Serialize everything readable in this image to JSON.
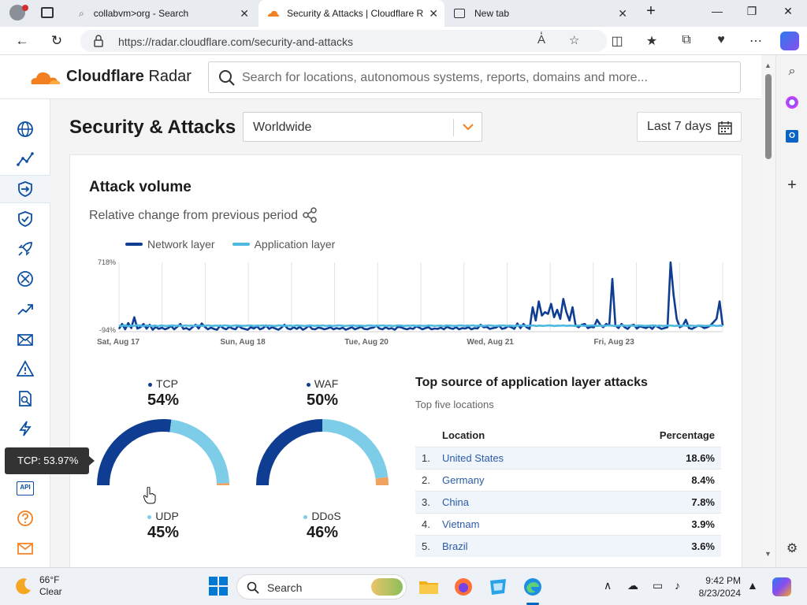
{
  "browser": {
    "tabs": [
      {
        "label": "collabvm>org - Search",
        "icon": "search-icon"
      },
      {
        "label": "Security & Attacks | Cloudflare R",
        "icon": "cloudflare-icon"
      },
      {
        "label": "New tab",
        "icon": "newtab-icon"
      }
    ],
    "url": "https://radar.cloudflare.com/security-and-attacks"
  },
  "header": {
    "brand_name": "Cloudflare",
    "brand_product": "Radar",
    "search_placeholder": "Search for locations, autonomous systems, reports, domains and more..."
  },
  "nav": {
    "items": [
      "globe-icon",
      "traffic-icon",
      "security-icon",
      "shield-icon",
      "rocket-icon",
      "network-icon",
      "trending-icon",
      "email-icon",
      "alert-icon",
      "domain-icon",
      "bolt-icon",
      "api-icon",
      "help-icon",
      "mail-icon"
    ],
    "api_label": "API",
    "selected": "security-icon"
  },
  "page": {
    "title": "Security & Attacks",
    "location": "Worldwide",
    "date_range": "Last 7 days"
  },
  "attack_volume": {
    "title": "Attack volume",
    "subtitle": "Relative change from previous period",
    "legend": [
      {
        "name": "Network layer",
        "color": "#0e3d92"
      },
      {
        "name": "Application layer",
        "color": "#4db8e0"
      }
    ],
    "y_max_label": "718%",
    "y_min_label": "-94%",
    "x_labels": [
      "Sat, Aug 17",
      "Sun, Aug 18",
      "Tue, Aug 20",
      "Wed, Aug 21",
      "Fri, Aug 23"
    ]
  },
  "chart_data": {
    "type": "line",
    "ylim": [
      -94,
      718
    ],
    "series": [
      {
        "name": "Network layer",
        "values": [
          -80,
          -20,
          -85,
          -10,
          -70,
          60,
          -75,
          -60,
          -20,
          -78,
          -30,
          -90,
          -55,
          -80,
          -65,
          -85,
          -70,
          -45,
          -85,
          -55,
          -20,
          -80,
          -70,
          -90,
          -60,
          -30,
          -75,
          -15,
          -55,
          -85,
          -65,
          -80,
          -90,
          -40,
          -70,
          -85,
          -55,
          -75,
          -85,
          -40,
          -70,
          -80,
          -90,
          -60,
          -75,
          -50,
          -85,
          -70,
          -40,
          -80,
          -60,
          -75,
          -90,
          -65,
          -30,
          -75,
          -85,
          -60,
          -80,
          -55,
          -90,
          -70,
          -40,
          -80,
          -85,
          -65,
          -70,
          -85,
          -75,
          -60,
          -85,
          -70,
          -80,
          -65,
          -90,
          -75,
          -60,
          -85,
          -70,
          -55,
          -80,
          -85,
          -70,
          -65,
          -40,
          -75,
          -85,
          -60,
          -80,
          -70,
          -90,
          -55,
          -60,
          -75,
          -85,
          -70,
          -80,
          -50,
          -65,
          -85,
          -70,
          -60,
          -85,
          -75,
          -80,
          -65,
          -85,
          -55,
          -70,
          -80,
          -60,
          -85,
          -70,
          -75,
          -60,
          -85,
          -70,
          -75,
          -30,
          -60,
          -55,
          -80,
          -70,
          -65,
          -40,
          -80,
          -70,
          -45,
          -60,
          -80,
          -15,
          -70,
          -20,
          -60,
          -80,
          180,
          20,
          250,
          80,
          120,
          100,
          220,
          60,
          150,
          40,
          280,
          120,
          20,
          180,
          -40,
          -60,
          -30,
          -20,
          -70,
          -55,
          -60,
          30,
          -30,
          -60,
          -20,
          -40,
          520,
          -40,
          -70,
          -20,
          -60,
          -80,
          -40,
          -30,
          -75,
          -50,
          -60,
          -70,
          -50,
          -80,
          -40,
          -60,
          -80,
          -70,
          -60,
          718,
          320,
          40,
          -60,
          -40,
          30,
          -70,
          -80,
          -60,
          -40,
          -50,
          -70,
          -60,
          -40,
          0,
          40,
          250,
          -40
        ]
      },
      {
        "name": "Application layer",
        "values": [
          -40,
          -45,
          -35,
          -50,
          -40,
          -45,
          -35,
          -40,
          -50,
          -38,
          -42,
          -45,
          -40,
          -48,
          -38,
          -42,
          -45,
          -40,
          -38,
          -44,
          -40,
          -46,
          -38,
          -42,
          -40,
          -45,
          -38,
          -42,
          -44,
          -40,
          -38,
          -45,
          -40,
          -42,
          -44,
          -38,
          -40,
          -46,
          -42,
          -38,
          -40,
          -44,
          -42,
          -40,
          -38,
          -45,
          -40,
          -42,
          -38,
          -44,
          -40,
          -42,
          -45,
          -38,
          -40,
          -44,
          -42,
          -40,
          -46,
          -38,
          -40,
          -42,
          -45,
          -40,
          -38,
          -44,
          -40,
          -42,
          -38,
          -45,
          -40,
          -44,
          -42,
          -38,
          -40,
          -45,
          -42,
          -40,
          -38,
          -44,
          -40,
          -42,
          -45,
          -38,
          -40,
          -44,
          -42,
          -40,
          -38,
          -45,
          -40,
          -44,
          -42,
          -38,
          -40,
          -45,
          -40,
          -42,
          -38,
          -44,
          -40,
          -42,
          -45,
          -38,
          -40,
          -44,
          -42,
          -40,
          -46,
          -38,
          -40,
          -42,
          -45,
          -40,
          -38,
          -44,
          -40,
          -42,
          -38,
          -45,
          -40,
          -44,
          -42,
          -38,
          -40,
          -45,
          -42,
          -40,
          -38,
          -44,
          -40,
          -42,
          -45,
          -38,
          -40,
          -44,
          -42,
          -40,
          -38,
          -45,
          -40,
          -44,
          -42,
          -38,
          -40,
          -45,
          -40,
          -42,
          -38,
          -44,
          -40,
          -42,
          -45,
          -38,
          -40,
          -44,
          -42,
          -40,
          -38,
          -45,
          -40,
          -44,
          -42,
          -38,
          -40,
          -45,
          -42,
          -40,
          -38,
          -44,
          -40,
          -42,
          -45,
          -38,
          -40,
          -44,
          -42,
          -40,
          -38,
          -45,
          -40,
          -44,
          -42,
          -38,
          -40,
          -45,
          -40,
          -42,
          -38,
          -44,
          -40,
          -42,
          -45,
          -38,
          -40,
          -44,
          -42,
          -40,
          -38,
          -45,
          -40,
          -44
        ]
      }
    ],
    "x_tick_labels": [
      "Sat, Aug 17",
      "Sun, Aug 18",
      "Tue, Aug 20",
      "Wed, Aug 21",
      "Fri, Aug 23"
    ],
    "grid": true
  },
  "gauges": [
    {
      "top_label": "TCP",
      "top_value": "54%",
      "bottom_label": "UDP",
      "bottom_value": "45%",
      "top_fraction": 0.5397,
      "bottom_fraction": 0.45,
      "other_fraction": 0.0103,
      "top_color": "#0e3d92",
      "bottom_color": "#7dcde9",
      "other_color": "#f0a35e"
    },
    {
      "top_label": "WAF",
      "top_value": "50%",
      "bottom_label": "DDoS",
      "bottom_value": "46%",
      "top_fraction": 0.5,
      "bottom_fraction": 0.46,
      "other_fraction": 0.04,
      "top_color": "#0e3d92",
      "bottom_color": "#7dcde9",
      "other_color": "#f0a35e"
    }
  ],
  "tooltip": "TCP: 53.97%",
  "top_sources": {
    "title": "Top source of application layer attacks",
    "subtitle": "Top five locations",
    "col_location": "Location",
    "col_percentage": "Percentage",
    "rows": [
      {
        "rank": "1.",
        "location": "United States",
        "pct": "18.6%"
      },
      {
        "rank": "2.",
        "location": "Germany",
        "pct": "8.4%"
      },
      {
        "rank": "3.",
        "location": "China",
        "pct": "7.8%"
      },
      {
        "rank": "4.",
        "location": "Vietnam",
        "pct": "3.9%"
      },
      {
        "rank": "5.",
        "location": "Brazil",
        "pct": "3.6%"
      }
    ]
  },
  "taskbar": {
    "temp": "66°F",
    "condition": "Clear",
    "search": "Search",
    "time": "9:42 PM",
    "date": "8/23/2024"
  }
}
